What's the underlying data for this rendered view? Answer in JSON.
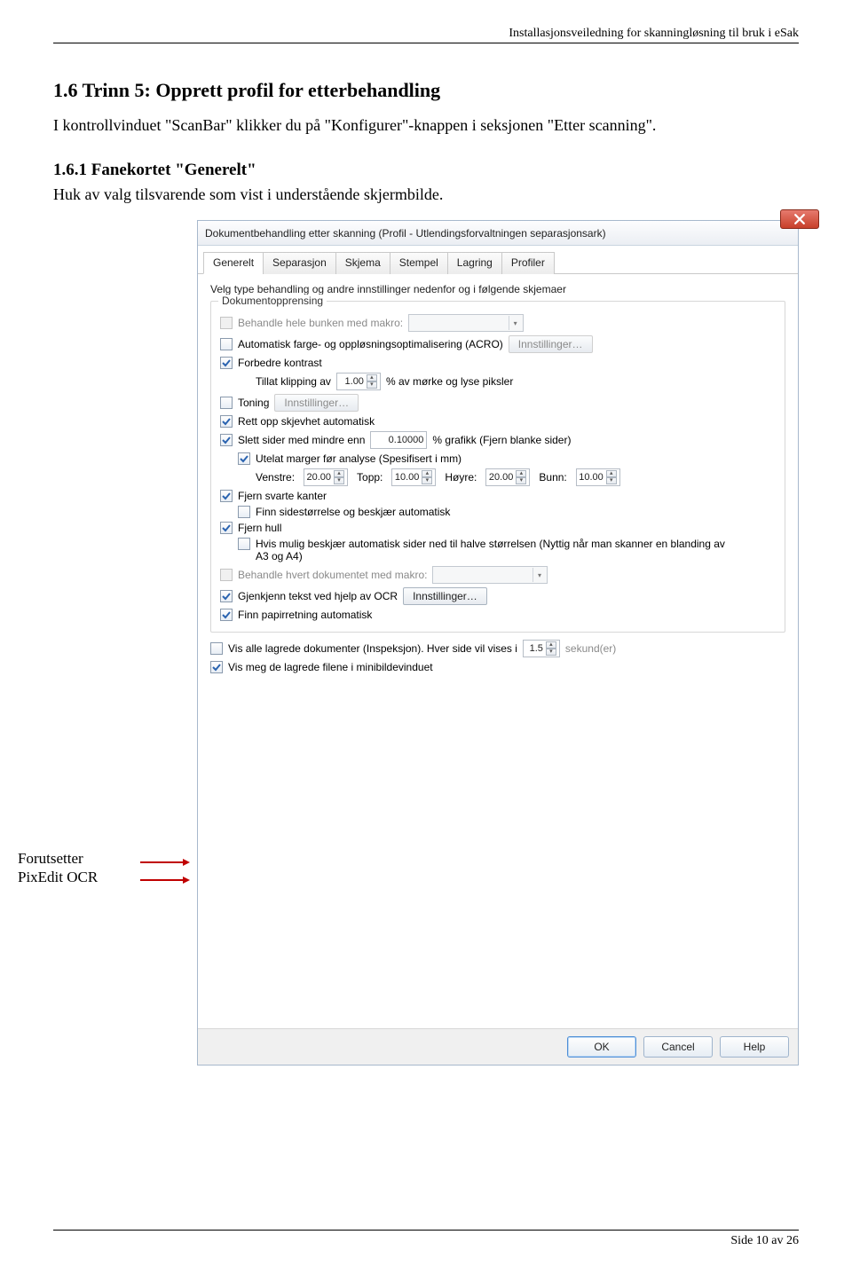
{
  "doc": {
    "running_header": "Installasjonsveiledning for skanningløsning til bruk i eSak",
    "heading": "1.6    Trinn 5: Opprett profil for etterbehandling",
    "intro": "I kontrollvinduet \"ScanBar\" klikker du på \"Konfigurer\"-knappen i seksjonen \"Etter scanning\".",
    "sub_heading": "1.6.1    Fanekortet \"Generelt\"",
    "sub_text": "Huk av valg tilsvarende som vist i understående skjermbilde.",
    "callout_line1": "Forutsetter",
    "callout_line2": "PixEdit OCR",
    "footer": "Side 10 av 26"
  },
  "dialog": {
    "title": "Dokumentbehandling etter skanning (Profil - Utlendingsforvaltningen separasjonsark)",
    "tabs": [
      "Generelt",
      "Separasjon",
      "Skjema",
      "Stempel",
      "Lagring",
      "Profiler"
    ],
    "lead": "Velg type behandling og andre innstillinger nedenfor og i følgende skjemaer",
    "group_title": "Dokumentopprensing",
    "cb_macro": "Behandle hele bunken med makro:",
    "cb_acro": "Automatisk farge- og oppløsningsoptimalisering (ACRO)",
    "btn_settings": "Innstillinger…",
    "cb_contrast": "Forbedre kontrast",
    "clip_lbl": "Tillat klipping av",
    "clip_val": "1.00",
    "clip_suffix": "% av mørke og lyse piksler",
    "cb_toning": "Toning",
    "cb_deskew": "Rett opp skjevhet automatisk",
    "cb_delblank": "Slett sider med mindre enn",
    "delblank_val": "0.10000",
    "delblank_suffix": "% grafikk (Fjern blanke sider)",
    "cb_margins": "Utelat marger før analyse (Spesifisert i mm)",
    "m_left": "Venstre:",
    "m_left_v": "20.00",
    "m_top": "Topp:",
    "m_top_v": "10.00",
    "m_right": "Høyre:",
    "m_right_v": "20.00",
    "m_bot": "Bunn:",
    "m_bot_v": "10.00",
    "cb_blackedges": "Fjern svarte kanter",
    "cb_autocrop": "Finn sidestørrelse og beskjær automatisk",
    "cb_holes": "Fjern hull",
    "cb_halfcrop": "Hvis mulig beskjær automatisk sider ned til halve størrelsen (Nyttig når man skanner en blanding av A3 og A4)",
    "cb_docmacro": "Behandle hvert dokumentet med makro:",
    "cb_ocr": "Gjenkjenn tekst ved hjelp av OCR",
    "cb_paperdir": "Finn papirretning automatisk",
    "cb_inspect": "Vis alle lagrede dokumenter (Inspeksjon). Hver side vil vises i",
    "inspect_val": "1.5",
    "inspect_suffix": "sekund(er)",
    "cb_minithumb": "Vis meg de lagrede filene i minibildevinduet",
    "footer": {
      "ok": "OK",
      "cancel": "Cancel",
      "help": "Help"
    }
  }
}
